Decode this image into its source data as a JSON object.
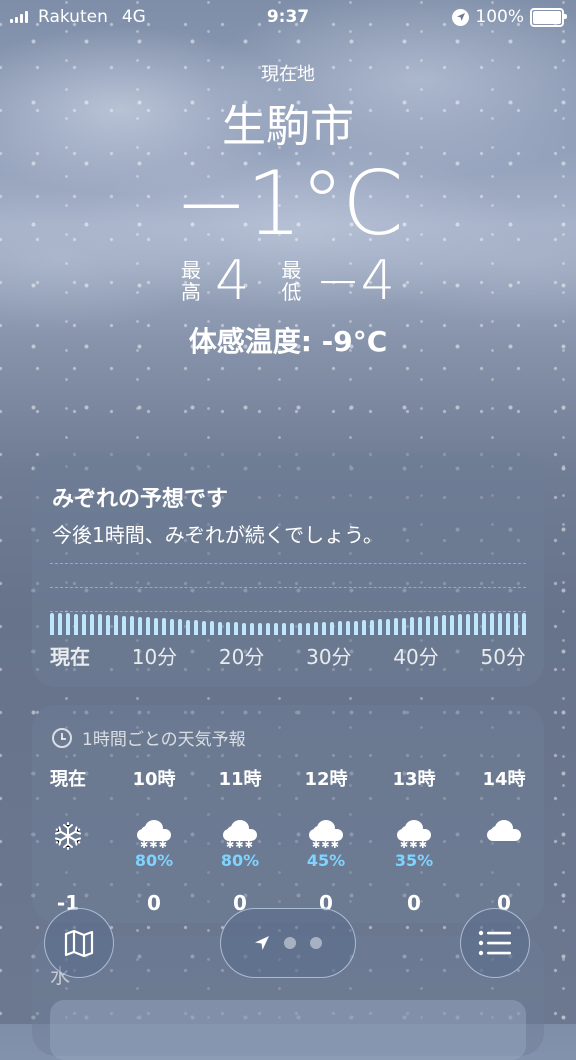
{
  "status_bar": {
    "carrier": "Rakuten",
    "network": "4G",
    "time": "9:37",
    "battery": "100%"
  },
  "header": {
    "location_label": "現在地",
    "city": "生駒市",
    "temperature": "−1°C",
    "high_label": "最高",
    "high": "4",
    "low_label": "最低",
    "low": "−4",
    "feels_like": "体感温度: -9°C"
  },
  "precipitation": {
    "title": "みぞれの予想です",
    "subtitle": "今後1時間、みぞれが続くでしょう。",
    "ticks": [
      "現在",
      "10分",
      "20分",
      "30分",
      "40分",
      "50分"
    ],
    "intensity": [
      0.9,
      0.9,
      0.9,
      0.88,
      0.88,
      0.86,
      0.86,
      0.84,
      0.82,
      0.8,
      0.78,
      0.76,
      0.74,
      0.72,
      0.7,
      0.68,
      0.66,
      0.64,
      0.62,
      0.6,
      0.58,
      0.56,
      0.55,
      0.54,
      0.52,
      0.52,
      0.5,
      0.5,
      0.5,
      0.5,
      0.5,
      0.52,
      0.52,
      0.54,
      0.56,
      0.56,
      0.58,
      0.6,
      0.6,
      0.62,
      0.64,
      0.66,
      0.68,
      0.7,
      0.72,
      0.74,
      0.76,
      0.78,
      0.8,
      0.82,
      0.84,
      0.86,
      0.88,
      0.9,
      0.9,
      0.9,
      0.9,
      0.9,
      0.9,
      0.9
    ],
    "bar_color": "#bfe6ff"
  },
  "hourly": {
    "title": "1時間ごとの天気予報",
    "hours": [
      {
        "time": "現在",
        "icon": "snowflake-icon",
        "pct": "",
        "temp": "-1"
      },
      {
        "time": "10時",
        "icon": "snow-cloud-icon",
        "pct": "80%",
        "temp": "0"
      },
      {
        "time": "11時",
        "icon": "snow-cloud-icon",
        "pct": "80%",
        "temp": "0"
      },
      {
        "time": "12時",
        "icon": "snow-cloud-icon",
        "pct": "45%",
        "temp": "0"
      },
      {
        "time": "13時",
        "icon": "snow-cloud-icon",
        "pct": "35%",
        "temp": "0"
      },
      {
        "time": "14時",
        "icon": "cloud-icon",
        "pct": "",
        "temp": "0"
      }
    ],
    "pct_color": "#7fd3ff"
  },
  "peek": {
    "text": "水"
  }
}
